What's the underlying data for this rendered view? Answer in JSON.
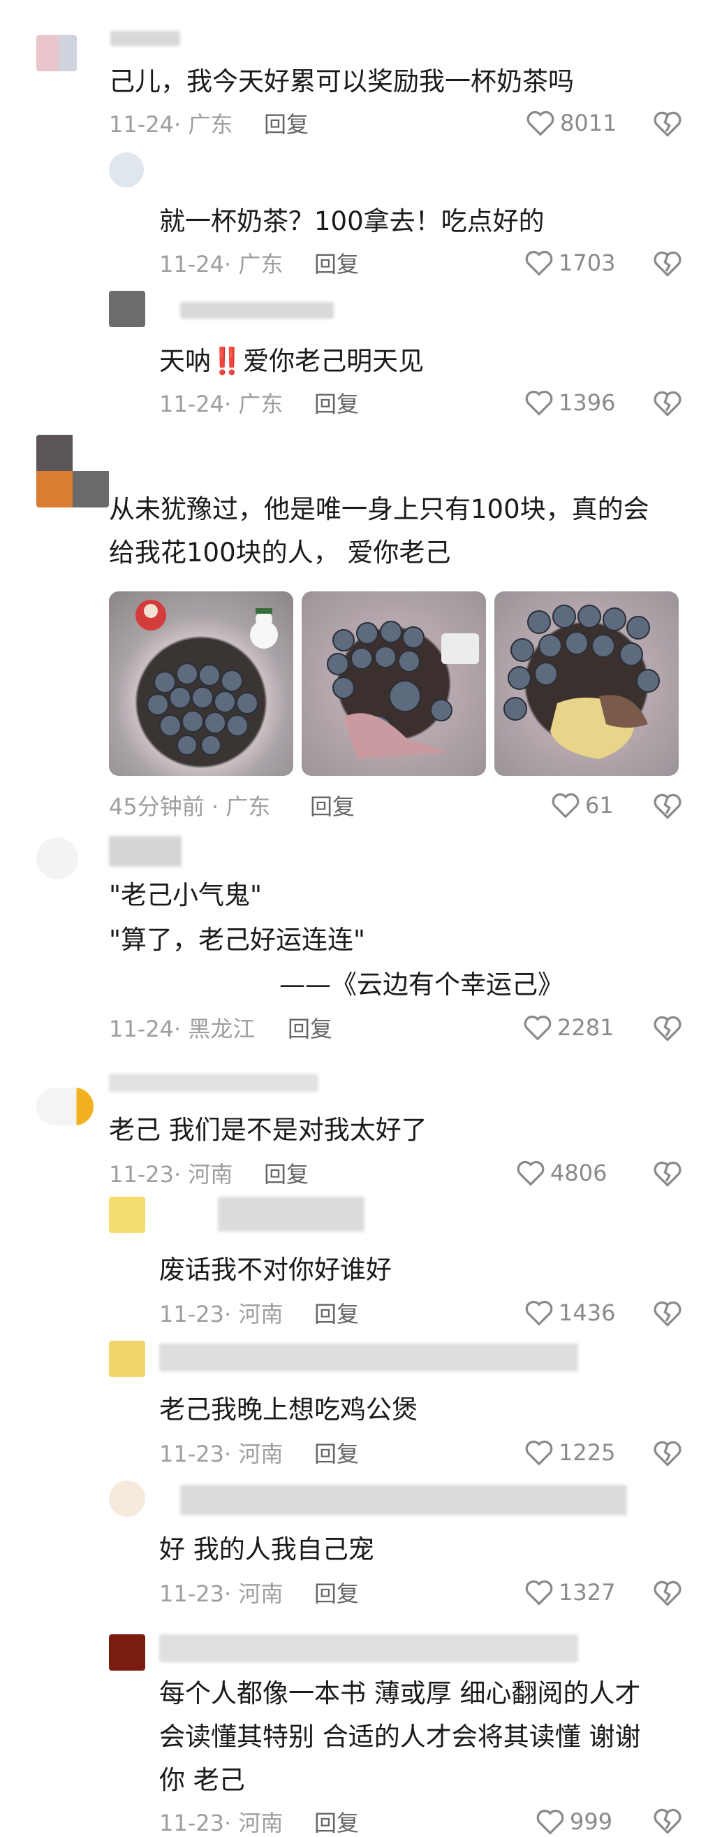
{
  "comments": [
    {
      "text": "己儿，我今天好累可以奖励我一杯奶茶吗",
      "meta": "11-24· 广东",
      "reply": "回复",
      "likes": "8011"
    },
    {
      "text": "就一杯奶茶？100拿去！吃点好的",
      "meta": "11-24· 广东",
      "reply": "回复",
      "likes": "1703"
    },
    {
      "text_pre": "天呐",
      "text_emoji": "‼️",
      "text_post": "爱你老己明天见",
      "meta": "11-24· 广东",
      "reply": "回复",
      "likes": "1396"
    },
    {
      "line1": "从未犹豫过，他是唯一身上只有100块，真的会",
      "line2": "给我花100块的人， 爱你老己",
      "meta": "45分钟前 · 广东",
      "reply": "回复",
      "likes": "61"
    },
    {
      "line1": "\"老己小气鬼\"",
      "line2": "\"算了，老己好运连连\"",
      "line3": "——《云边有个幸运己》",
      "meta": "11-24· 黑龙江",
      "reply": "回复",
      "likes": "2281"
    },
    {
      "text": "老己 我们是不是对我太好了",
      "meta": "11-23· 河南",
      "reply": "回复",
      "likes": "4806"
    },
    {
      "text": "废话我不对你好谁好",
      "meta": "11-23· 河南",
      "reply": "回复",
      "likes": "1436"
    },
    {
      "text": "老己我晚上想吃鸡公煲",
      "meta": "11-23· 河南",
      "reply": "回复",
      "likes": "1225"
    },
    {
      "text": "好 我的人我自己宠",
      "meta": "11-23· 河南",
      "reply": "回复",
      "likes": "1327"
    },
    {
      "line1": "每个人都像一本书 薄或厚 细心翻阅的人才",
      "line2": "会读懂其特别 合适的人才会将其读懂 谢谢",
      "line3": "你 老己",
      "meta": "11-23· 河南",
      "reply": "回复",
      "likes": "999"
    }
  ],
  "colors": {
    "text": "#1a1a1a",
    "meta": "#9e9e9e",
    "icon": "#8a8a8a"
  }
}
